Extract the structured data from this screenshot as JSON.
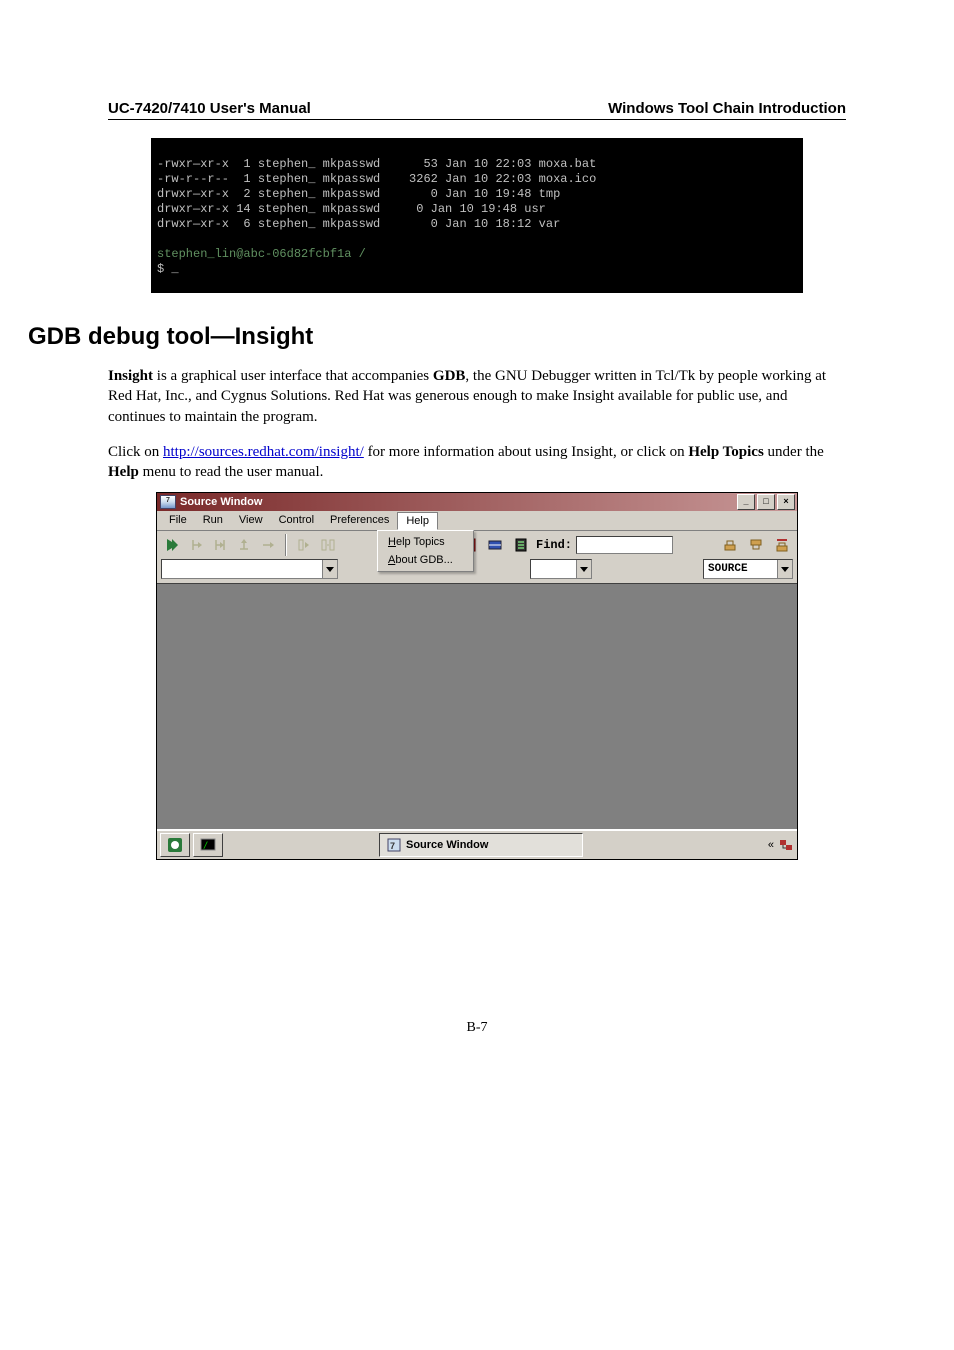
{
  "header": {
    "left": "UC-7420/7410 User's Manual",
    "right": "Windows Tool Chain Introduction"
  },
  "terminal_lines": [
    "-rwxr—xr-x  1 stephen_ mkpasswd      53 Jan 10 22:03 moxa.bat",
    "-rw-r--r--  1 stephen_ mkpasswd    3262 Jan 10 22:03 moxa.ico",
    "drwxr—xr-x  2 stephen_ mkpasswd       0 Jan 10 19:48 tmp",
    "drwxr—xr-x 14 stephen_ mkpasswd     0 Jan 10 19:48 usr",
    "drwxr—xr-x  6 stephen_ mkpasswd       0 Jan 10 18:12 var"
  ],
  "terminal_prompt": "stephen_lin@abc-06d82fcbf1a /",
  "terminal_cursor": "$ _",
  "section_title": "GDB debug tool—Insight",
  "para1_parts": {
    "p1a": "Insight",
    "p1b": " is a graphical user interface that accompanies ",
    "p1c": "GDB",
    "p1d": ", the GNU Debugger written in Tcl/Tk by people working at Red Hat, Inc., and Cygnus Solutions. Red Hat was generous enough to make Insight available for public use, and continues to maintain the program."
  },
  "para2_parts": {
    "p2a": "Click on ",
    "p2link": "http://sources.redhat.com/insight/",
    "p2b": " for more information about using Insight, or click on ",
    "p2c": "Help Topics",
    "p2d": " under the ",
    "p2e": "Help",
    "p2f": " menu to read the user manual."
  },
  "app": {
    "title": "Source Window",
    "menus": [
      "File",
      "Run",
      "View",
      "Control",
      "Preferences",
      "Help"
    ],
    "help_items": [
      "Help Topics",
      "About GDB..."
    ],
    "find_label": "Find:",
    "source_label": "SOURCE",
    "taskbar_item": "Source Window",
    "tray_symbol": "«"
  },
  "footer": "B-7"
}
